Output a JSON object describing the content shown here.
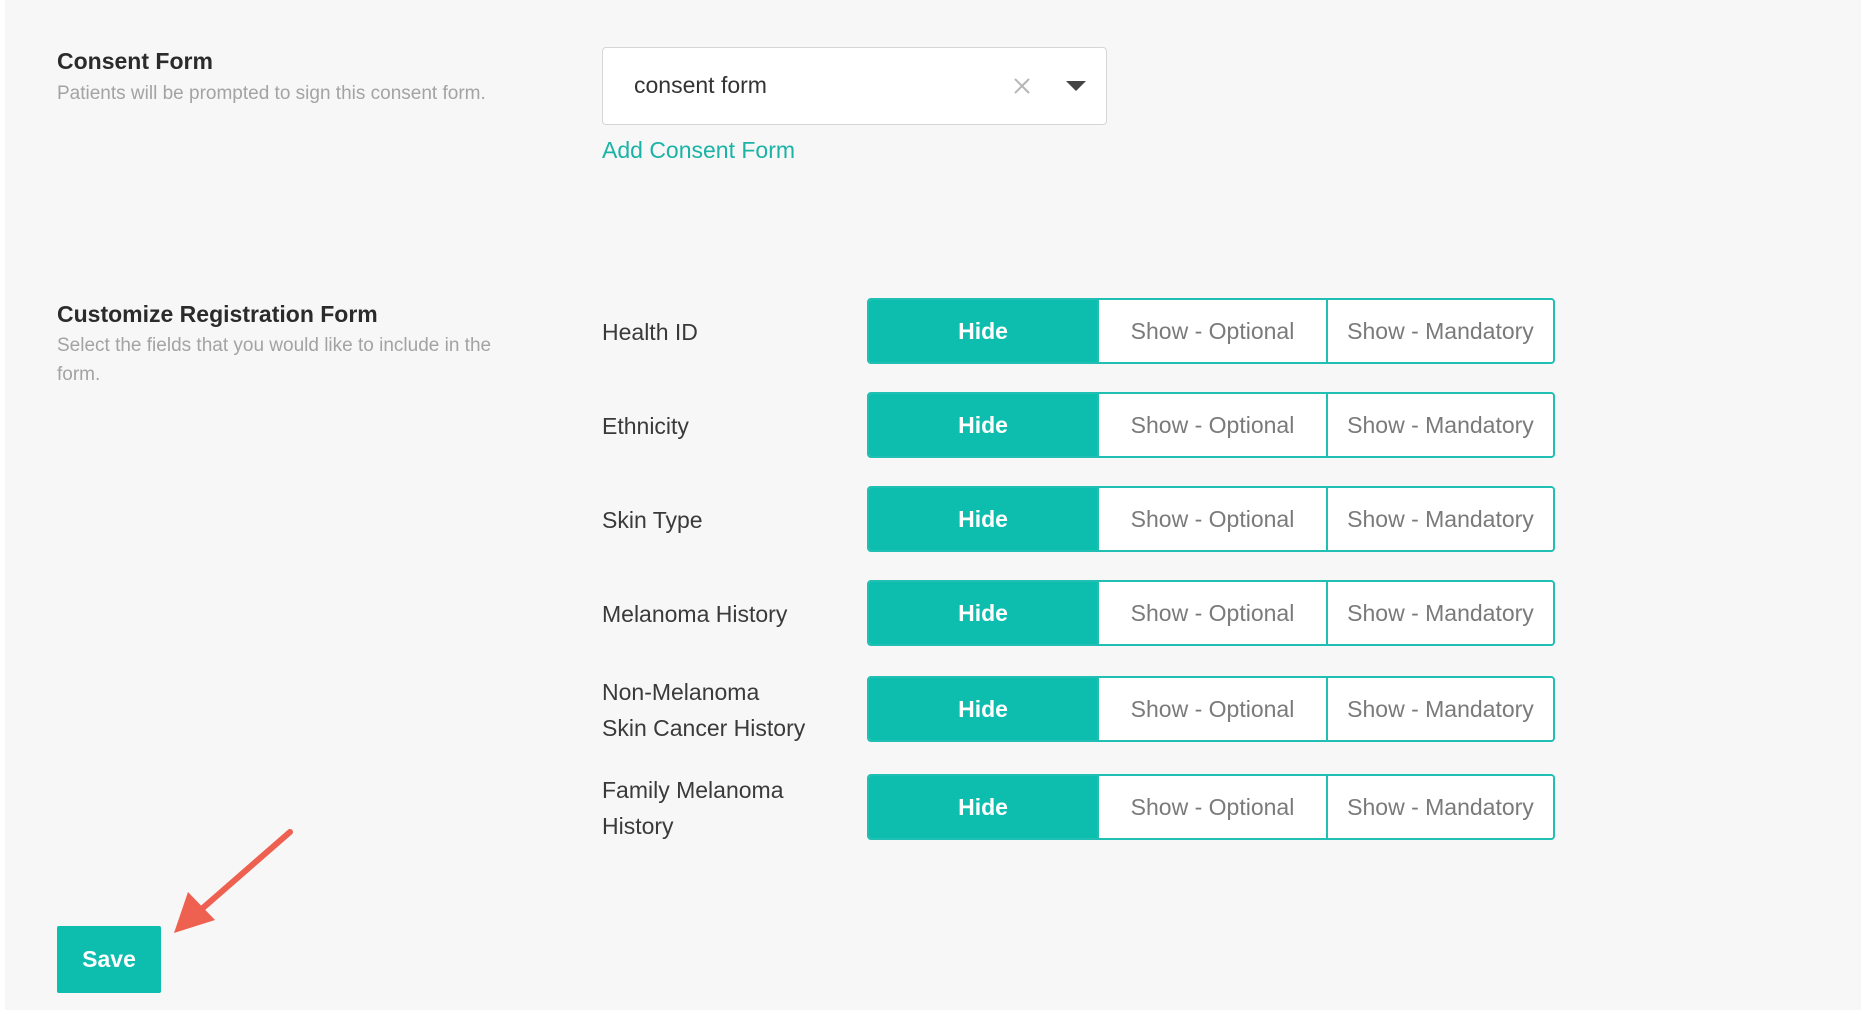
{
  "consent_form": {
    "title": "Consent Form",
    "description": "Patients will be prompted to sign this consent form.",
    "select_value": "consent form",
    "clear_icon": "close-icon",
    "dropdown_icon": "caret-down-icon",
    "add_link": "Add Consent Form"
  },
  "registration_form": {
    "title": "Customize Registration Form",
    "description": "Select the fields that you would like to include in the form.",
    "options": [
      "Hide",
      "Show - Optional",
      "Show - Mandatory"
    ],
    "fields": [
      {
        "label": "Health ID",
        "selected": "Hide"
      },
      {
        "label": "Ethnicity",
        "selected": "Hide"
      },
      {
        "label": "Skin Type",
        "selected": "Hide"
      },
      {
        "label": "Melanoma History",
        "selected": "Hide"
      },
      {
        "label_line1": "Non-Melanoma",
        "label_line2": "Skin Cancer History",
        "selected": "Hide"
      },
      {
        "label_line1": "Family Melanoma",
        "label_line2": "History",
        "selected": "Hide"
      }
    ]
  },
  "save_label": "Save",
  "annotation": {
    "arrow_color": "#ee6150",
    "arrow_icon": "arrow-annotation-icon"
  },
  "colors": {
    "accent": "#0dbdae",
    "link": "#1ab3a6",
    "panel_background": "#f7f7f7"
  }
}
